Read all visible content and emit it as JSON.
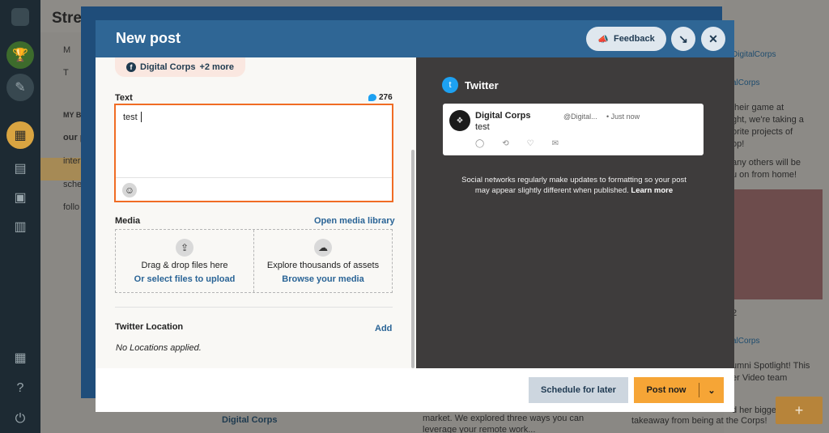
{
  "background": {
    "title": "Stre",
    "sidebar": [
      "M",
      "T",
      "MY BO",
      "our p",
      "inter",
      "sche",
      "follo"
    ],
    "right_column": {
      "account": "DigitalCorps",
      "post1_link": "alCorps",
      "post1_lines": [
        "their game at",
        "ght, we're taking a",
        "orite projects of",
        "op!",
        "",
        "any others will be",
        "u on from home!"
      ],
      "likes": "2",
      "post2_link": "alCorps",
      "post2_lines": [
        "umni Spotlight! This",
        "er Video team"
      ],
      "bottom_lines": [
        "d her bigge",
        "takeaway from being at the Corps!"
      ]
    },
    "middle_bottom": {
      "account": "Digital Corps",
      "lines": [
        "market. We explored three ways you can",
        "leverage your remote work..."
      ]
    },
    "plus": "+"
  },
  "modal": {
    "title": "New post",
    "feedback_label": "Feedback",
    "minimize_icon": "↘",
    "close_icon": "✕",
    "profiles_label": "Digital Corps",
    "profiles_more": "+2 more",
    "text_label": "Text",
    "char_count": "276",
    "text_value": "test",
    "media_label": "Media",
    "open_media_library": "Open media library",
    "upload_line1": "Drag & drop files here",
    "upload_line2": "Or select files to upload",
    "explore_line1": "Explore thousands of assets",
    "explore_line2": "Browse your media",
    "location_label": "Twitter Location",
    "location_add": "Add",
    "location_empty": "No Locations applied.",
    "preview": {
      "network": "Twitter",
      "account_name": "Digital Corps",
      "handle": "@Digital...",
      "time": "• Just now",
      "tweet_text": "test",
      "disclaimer_line1": "Social networks regularly make updates to formatting so your post",
      "disclaimer_line2": "may appear slightly different when published.",
      "learn_more": "Learn more"
    },
    "schedule_label": "Schedule for later",
    "post_label": "Post now"
  }
}
